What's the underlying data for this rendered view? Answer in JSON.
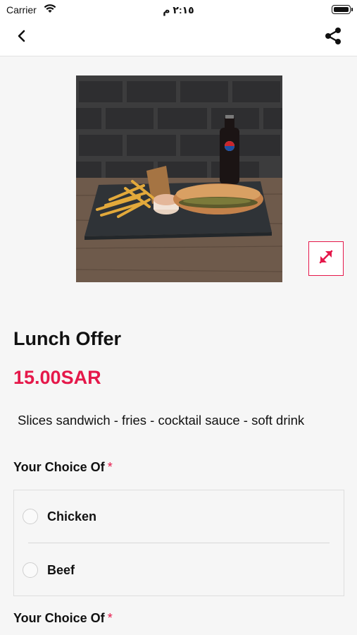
{
  "status_bar": {
    "carrier": "Carrier",
    "time": "٢:١٥ م"
  },
  "nav": {
    "back_icon": "chevron-left-icon",
    "share_icon": "share-icon"
  },
  "product": {
    "title": "Lunch Offer",
    "price": "15.00SAR",
    "description": "Slices sandwich - fries - cocktail sauce - soft drink",
    "expand_icon": "expand-arrows-icon"
  },
  "choices": [
    {
      "title": "Your Choice Of",
      "required_marker": "*",
      "options": [
        {
          "label": "Chicken",
          "selected": false
        },
        {
          "label": "Beef",
          "selected": false
        }
      ]
    },
    {
      "title": "Your Choice Of",
      "required_marker": "*"
    }
  ],
  "colors": {
    "accent": "#e5184a",
    "background": "#f6f6f6"
  }
}
